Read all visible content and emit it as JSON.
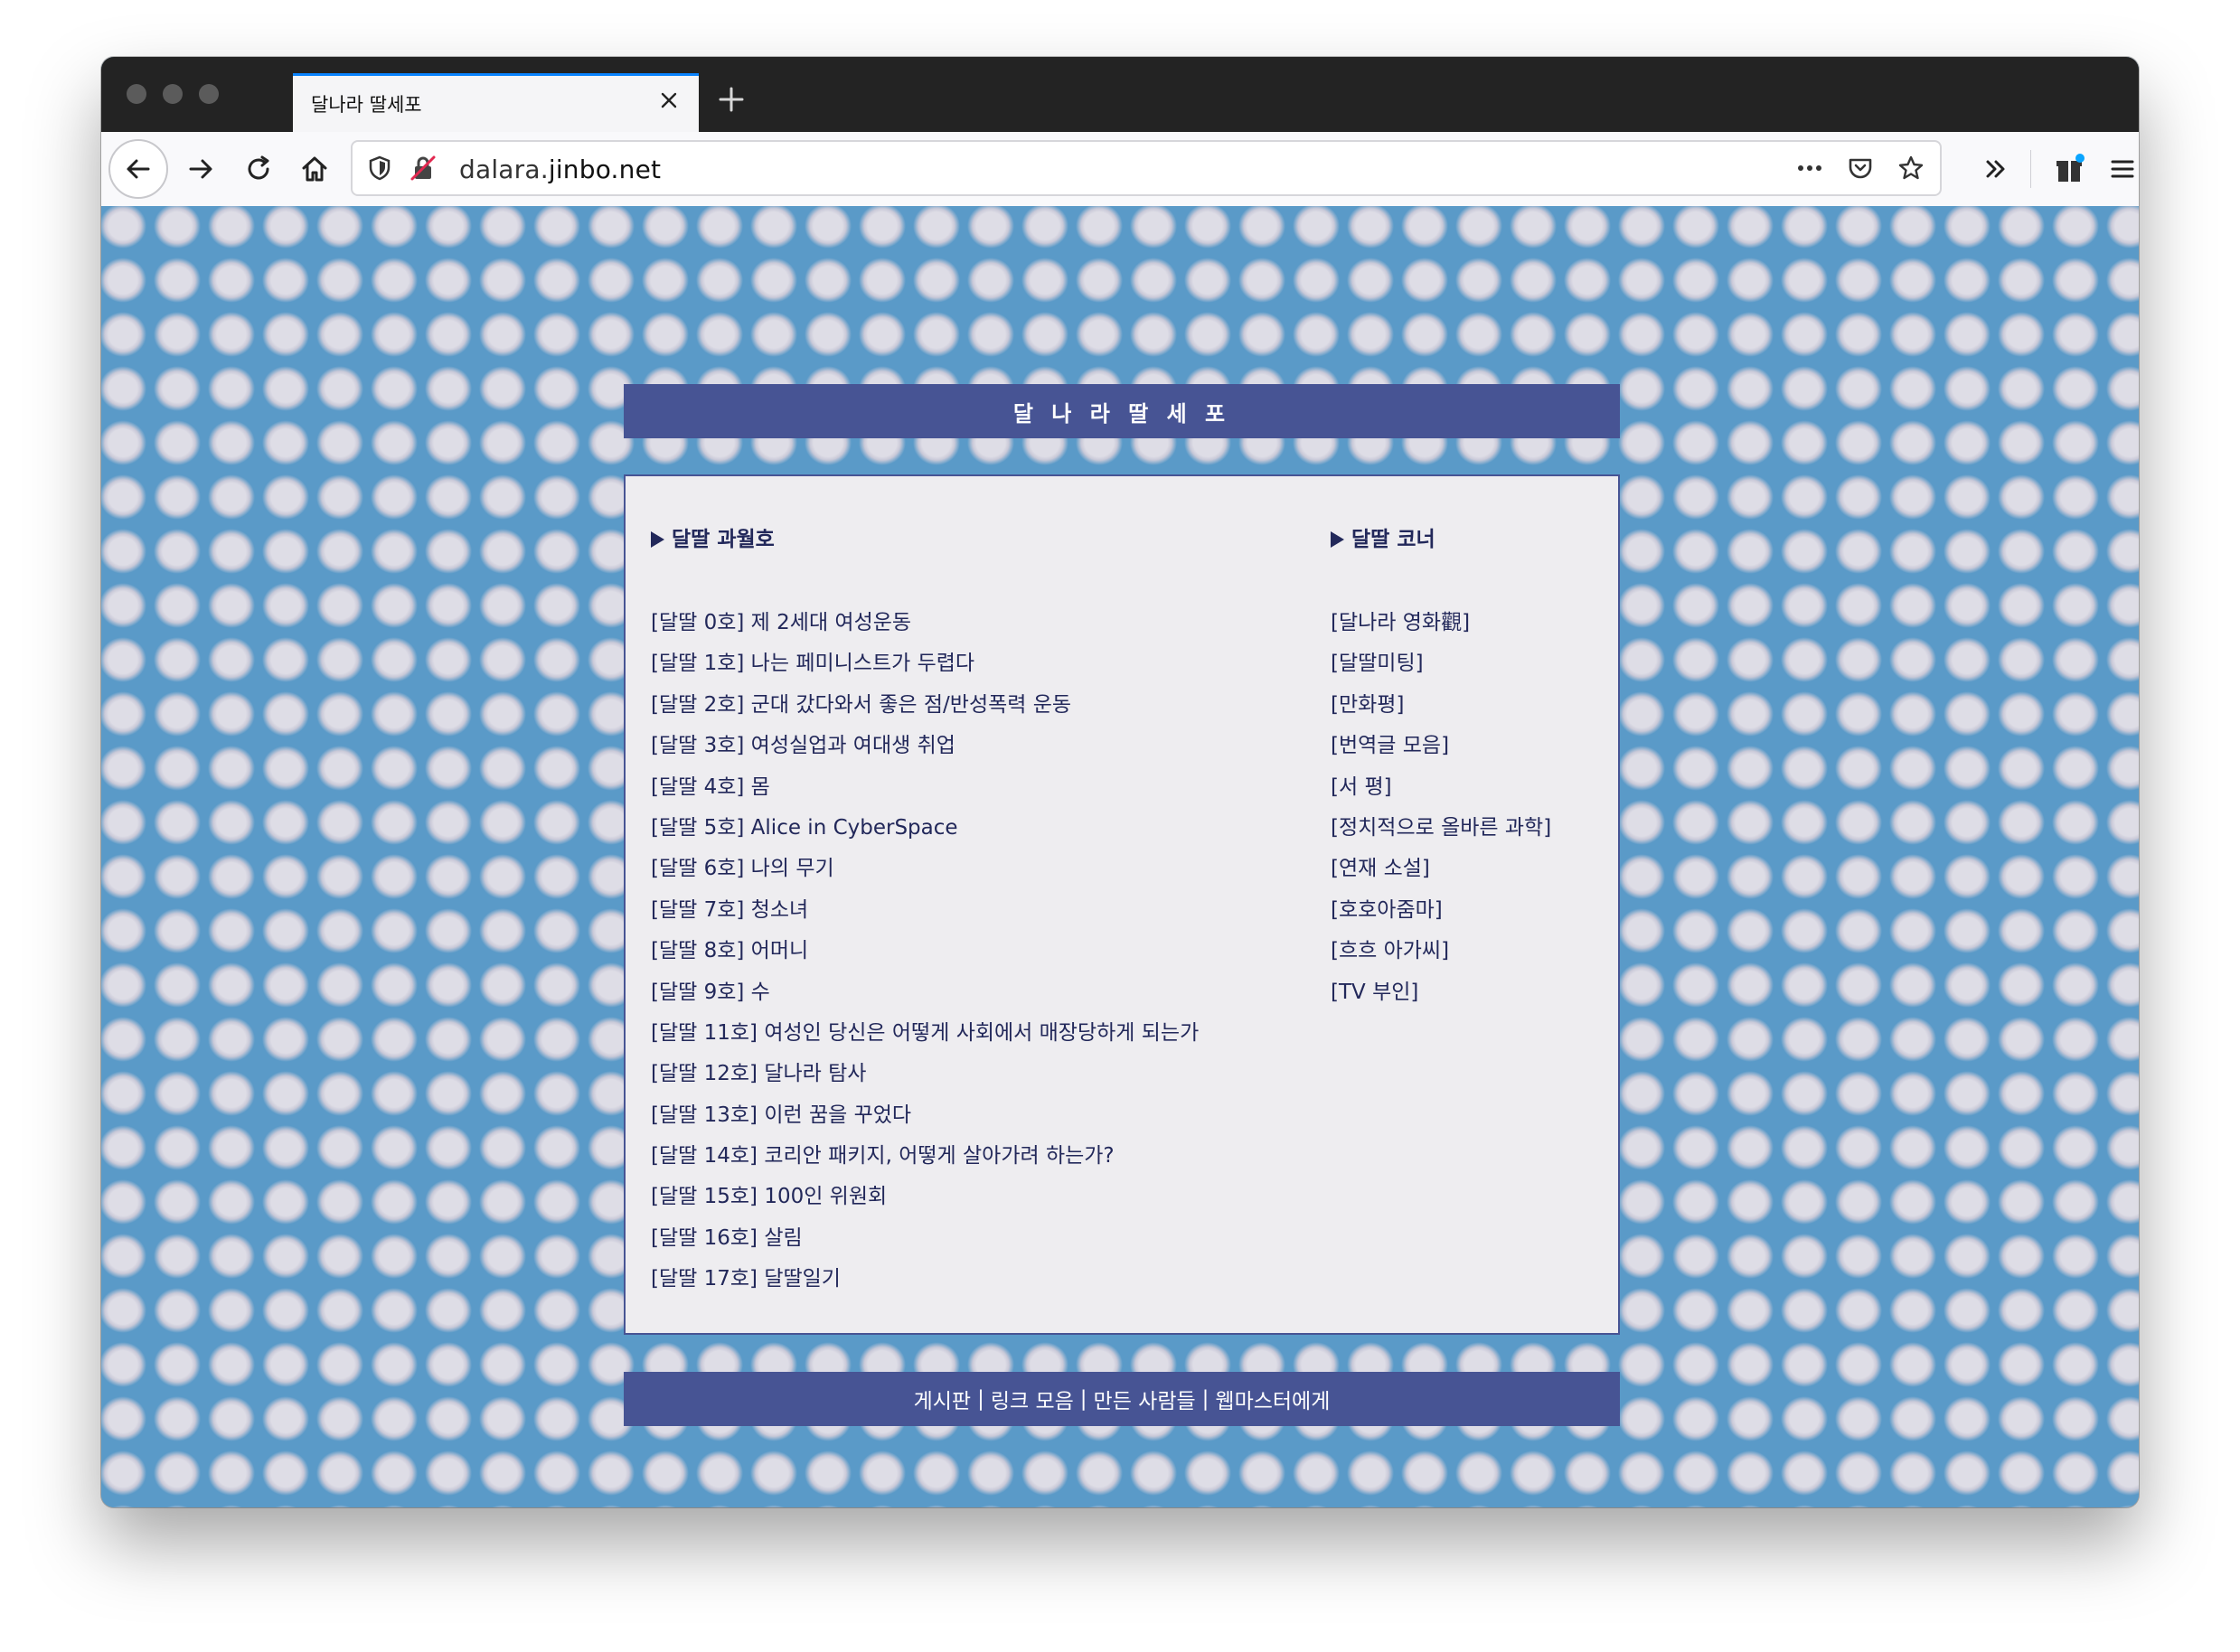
{
  "browser": {
    "tab_title": "달나라 딸세포",
    "url_prefix": "dalara.",
    "url_domain": "jinbo.net"
  },
  "site": {
    "title": "달 나 라 딸 세 포",
    "left_column": {
      "heading": "달딸 과월호",
      "items": [
        "[달딸 0호] 제 2세대 여성운동",
        "[달딸 1호] 나는 페미니스트가 두렵다",
        "[달딸 2호] 군대 갔다와서 좋은 점/반성폭력 운동",
        "[달딸 3호] 여성실업과 여대생 취업",
        "[달딸 4호] 몸",
        "[달딸 5호] Alice in CyberSpace",
        "[달딸 6호] 나의 무기",
        "[달딸 7호] 청소녀",
        "[달딸 8호] 어머니",
        "[달딸 9호] 수",
        "[달딸 11호] 여성인 당신은 어떻게 사회에서 매장당하게 되는가",
        "[달딸 12호] 달나라 탐사",
        "[달딸 13호] 이런 꿈을 꾸었다",
        "[달딸 14호] 코리안 패키지, 어떻게 살아가려 하는가?",
        "[달딸 15호] 100인 위원회",
        "[달딸 16호] 살림",
        "[달딸 17호] 달딸일기"
      ]
    },
    "right_column": {
      "heading": "달딸 코너",
      "items": [
        "[달나라 영화觀]",
        "[달딸미팅]",
        "[만화평]",
        "[번역글 모음]",
        "[서 평]",
        "[정치적으로 올바른 과학]",
        "[연재 소설]",
        "[호호아줌마]",
        "[흐흐 아가씨]",
        "[TV 부인]"
      ]
    },
    "footer": {
      "links": [
        "게시판",
        "링크 모음",
        "만든 사람들",
        "웹마스터에게"
      ],
      "separator": "|"
    }
  },
  "colors": {
    "accent_bar": "#475494",
    "content_bg": "#eeedf0",
    "page_bg": "#5a9ac8",
    "text": "#22285a"
  }
}
